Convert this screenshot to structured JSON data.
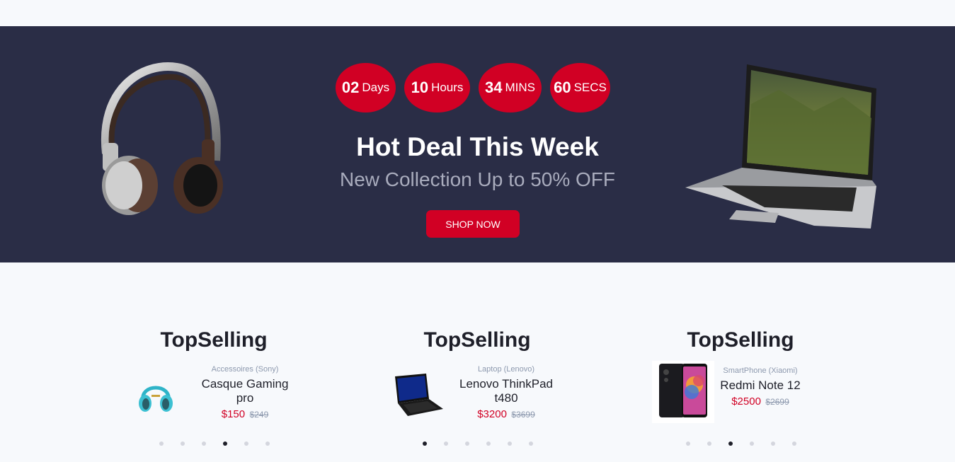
{
  "deal": {
    "countdown": [
      {
        "num": "02",
        "unit": "Days"
      },
      {
        "num": "10",
        "unit": "Hours"
      },
      {
        "num": "34",
        "unit": "MINS"
      },
      {
        "num": "60",
        "unit": "SECS"
      }
    ],
    "title": "Hot Deal This Week",
    "subtitle": "New Collection Up to 50% OFF",
    "button": "SHOP NOW",
    "accent_color": "#d10024",
    "bg_color": "#2a2d46"
  },
  "top_selling": [
    {
      "title": "TopSelling",
      "product": {
        "category": "Accessoires (Sony)",
        "name": "Casque Gaming pro",
        "price": "$150",
        "old_price": "$249",
        "image": "headphones-icon"
      },
      "dots": 6,
      "active_dot": 3
    },
    {
      "title": "TopSelling",
      "product": {
        "category": "Laptop (Lenovo)",
        "name": "Lenovo ThinkPad t480",
        "price": "$3200",
        "old_price": "$3699",
        "image": "laptop-icon"
      },
      "dots": 6,
      "active_dot": 0
    },
    {
      "title": "TopSelling",
      "product": {
        "category": "SmartPhone (Xiaomi)",
        "name": "Redmi Note 12",
        "price": "$2500",
        "old_price": "$2699",
        "image": "smartphone-icon"
      },
      "dots": 6,
      "active_dot": 2
    }
  ]
}
